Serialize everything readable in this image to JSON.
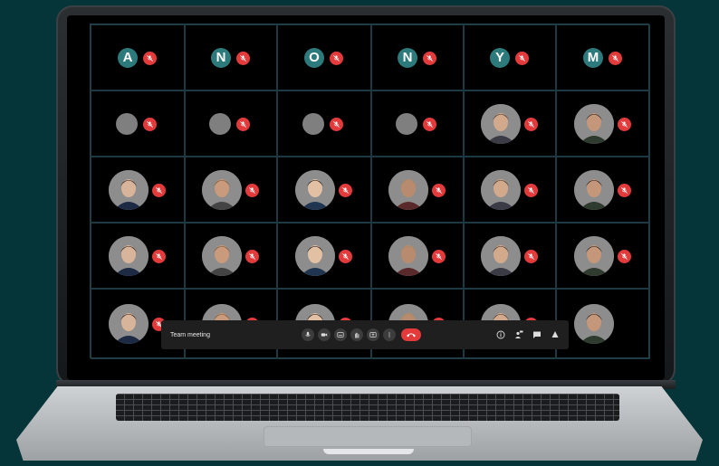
{
  "meeting": {
    "title": "Team meeting"
  },
  "colors": {
    "background": "#053439",
    "muted_badge": "#e33b3b",
    "letter_avatar": "#2d7a7d",
    "toolbar": "#1f1f1f"
  },
  "participants": [
    {
      "type": "letter",
      "label": "A",
      "muted": true
    },
    {
      "type": "letter",
      "label": "N",
      "muted": true
    },
    {
      "type": "letter",
      "label": "O",
      "muted": true
    },
    {
      "type": "letter",
      "label": "N",
      "muted": true
    },
    {
      "type": "letter",
      "label": "Y",
      "muted": true
    },
    {
      "type": "letter",
      "label": "M",
      "muted": true
    },
    {
      "type": "empty",
      "muted": true
    },
    {
      "type": "empty",
      "muted": true
    },
    {
      "type": "empty",
      "muted": true
    },
    {
      "type": "empty",
      "muted": true
    },
    {
      "type": "photo",
      "muted": true
    },
    {
      "type": "photo",
      "muted": true
    },
    {
      "type": "photo",
      "muted": true
    },
    {
      "type": "photo",
      "muted": true
    },
    {
      "type": "photo",
      "muted": true
    },
    {
      "type": "photo",
      "muted": true
    },
    {
      "type": "photo",
      "muted": true
    },
    {
      "type": "photo",
      "muted": true
    },
    {
      "type": "photo",
      "muted": true
    },
    {
      "type": "photo",
      "muted": true
    },
    {
      "type": "photo",
      "muted": true
    },
    {
      "type": "photo",
      "muted": true
    },
    {
      "type": "photo",
      "muted": true
    },
    {
      "type": "photo",
      "muted": true
    },
    {
      "type": "photo",
      "muted": true
    },
    {
      "type": "photo",
      "muted": true
    },
    {
      "type": "photo",
      "muted": true
    },
    {
      "type": "photo",
      "muted": true
    },
    {
      "type": "photo",
      "muted": true
    },
    {
      "type": "photo",
      "muted": false
    }
  ],
  "controls": {
    "center": [
      "mic-icon",
      "camera-icon",
      "captions-icon",
      "raise-hand-icon",
      "present-icon",
      "more-options-icon"
    ],
    "hangup": "hang-up-icon",
    "right": [
      "info-icon",
      "people-icon",
      "chat-icon",
      "activities-icon"
    ]
  }
}
